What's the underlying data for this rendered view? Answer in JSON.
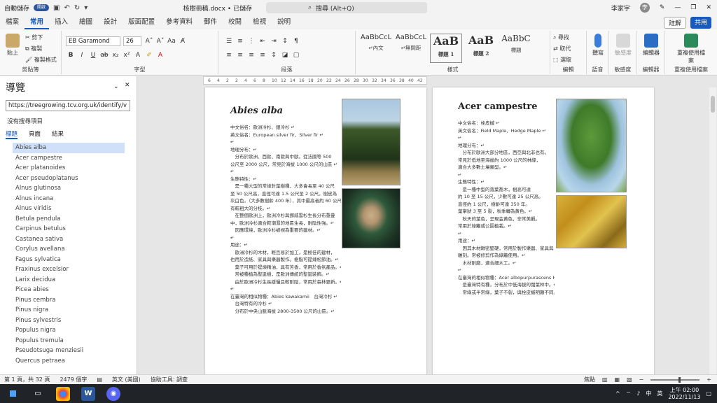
{
  "titlebar": {
    "autosave": "自動儲存",
    "toggle": "開啟",
    "doc_title": "核樹冊稿.docx • 已儲存",
    "search_placeholder": "搜尋 (Alt+Q)",
    "user": "李家宇",
    "user_initial": "李"
  },
  "tabs": [
    "檔案",
    "常用",
    "插入",
    "繪圖",
    "設計",
    "版面配置",
    "參考資料",
    "郵件",
    "校閱",
    "檢視",
    "說明"
  ],
  "active_tab": "常用",
  "tab_buttons": {
    "comment": "註解",
    "share": "共用"
  },
  "ribbon": {
    "paste": "貼上",
    "cut": "剪下",
    "copy": "複製",
    "format_painter": "複製格式",
    "clipboard": "剪貼簿",
    "font_name": "EB Garamond",
    "font_size": "26",
    "font_group": "字型",
    "paragraph_group": "段落",
    "styles_group": "樣式",
    "styles": [
      {
        "preview": "AaBbCcL",
        "name": "↵內文"
      },
      {
        "preview": "AaBbCcL",
        "name": "↵無間距"
      },
      {
        "preview": "AaB",
        "name": "標題 1"
      },
      {
        "preview": "AaB",
        "name": "標題 2"
      },
      {
        "preview": "AaBbC",
        "name": "標題"
      }
    ],
    "find": "尋找",
    "replace": "取代",
    "select": "選取",
    "editing_group": "編輯",
    "dictate": "聽寫",
    "voice_group": "語音",
    "sensitivity": "敏感度",
    "sensitivity_group": "敏感度",
    "editor": "編輯器",
    "editor_group": "編輯器",
    "reuse": "重複使用檔案",
    "reuse_group": "重複使用檔案"
  },
  "nav": {
    "title": "導覽",
    "url": "https://treegrowing.tcv.org.uk/identify/v",
    "note": "沒有搜尋項目",
    "tabs": [
      "標題",
      "頁面",
      "結果"
    ],
    "items": [
      "Abies alba",
      "Acer campestre",
      "Acer platanoides",
      "Acer pseudoplatanus",
      "Alnus glutinosa",
      "Alnus incana",
      "Alnus viridis",
      "Betula pendula",
      "Carpinus betulus",
      "Castanea sativa",
      "Corylus avellana",
      "Fagus sylvatica",
      "Fraxinus excelsior",
      "Larix decidua",
      "Picea abies",
      "Pinus cembra",
      "Pinus nigra",
      "Pinus sylvestris",
      "Populus nigra",
      "Populus tremula",
      "Pseudotsuga menziesii",
      "Quercus petraea"
    ],
    "selected": "Abies alba"
  },
  "ruler_marks": [
    "6",
    "4",
    "2",
    "2",
    "4",
    "6",
    "8",
    "10",
    "12",
    "14",
    "16",
    "18",
    "20",
    "22",
    "24",
    "26",
    "28",
    "30",
    "32",
    "34",
    "36",
    "38",
    "40",
    "42"
  ],
  "page1": {
    "title": "Abies alba",
    "lines": [
      "中文俗名：歐洲冷杉、銀冷杉 ↵",
      "英文俗名：European silver fir、Silver fir ↵",
      "↵",
      "地理分布：↵",
      "　分布於歐洲、西歐、南歐與中歐。從法國等 500",
      "公尺至 2000 公尺，常見於海拔 1000 公尺的山區 ↵",
      "↵",
      "生態特性：↵",
      "　是一種大型的常綠針葉樹種，大多會長至 40 公尺",
      "至 50 公尺高，直徑可達 1.5 公尺至 2 公尺。樹皮為",
      "灰白色，（大多數樹齡 400 年），其中最高者約 60 公尺，樹",
      "有較粗大的分枝。↵",
      "　在整個歐洲上，歐洲冷杉與挪威雲杉生長分布重疊",
      "中，歐洲冷杉適合較潮濕的地區生長，耐陰性強。↵",
      "　因應環境，歐洲冷杉被視為重要的建材。↵",
      "↵",
      "用途：↵",
      "　歐洲冷杉的木材，輕且易於加工，是極佳的建材，",
      "也用於造紙、家具與樂器製作。樹脂可提煉松節油。↵",
      "　葉子可用於提煉精油，具有芳香，常用於香氛產品。↵",
      "　常被種植為聖誕樹，是歐洲傳統的聖誕裝飾。↵",
      "　由於歐洲冷杉生長緩慢且較耐陰，常用於森林更新。↵",
      "↵",
      "在臺灣的相似物種：Abies kawakamii　台灣冷杉 ↵",
      "　台灣特有的冷杉 ↵",
      "　分布於中央山脈海拔 2800-3500 公尺的山區。↵"
    ]
  },
  "page2": {
    "title": "Acer campestre",
    "lines": [
      "中文俗名：栓皮槭 ↵",
      "英文俗名：Field Maple、Hedge Maple ↵",
      "↵",
      "地理分布：↵",
      "　分布於歐洲大部分地區，西亞與北非也有。",
      "常見於低地至海拔約 1000 公尺的林緣，",
      "適合大多數土壤類型。↵",
      "↵",
      "生態特性：↵",
      "　是一種中型的落葉喬木，樹高可達",
      "約 10 至 15 公尺，少數可達 25 公尺高。",
      "直徑約 1 公尺，樹齡可達 350 年。",
      "葉掌狀 3 至 5 裂，秋季轉為黃色。↵",
      "　秋天的葉色，呈現金黃色，非常美觀。",
      "常用於綠籬或公園植栽。↵",
      "↵",
      "用途：↵",
      "　因其木材緻密堅硬，常用於製作樂器、家具與",
      "雕刻。常被修剪作為綠籬使用。↵",
      "　木材耐磨，適合細木工。↵",
      "↵",
      "在臺灣的相似物種：Acer albopurpurascens Hay.　樟葉槭 ↵",
      "　是臺灣特有種，分布於中低海拔的闊葉林中。↵",
      "　常綠或半常綠，葉子不裂，與栓皮槭明顯不同。↵"
    ]
  },
  "status": {
    "page": "第 1 頁，共 32 頁",
    "words": "2479 個字",
    "lang": "英文 (美國)",
    "access": "協助工具: 調查",
    "focus": "焦點"
  },
  "taskbar": {
    "time": "上午 02:00",
    "date": "2022/11/13",
    "ime": "中",
    "lang2": "英"
  },
  "colors": {
    "accent": "#185abd",
    "taskbar": "#202428"
  }
}
